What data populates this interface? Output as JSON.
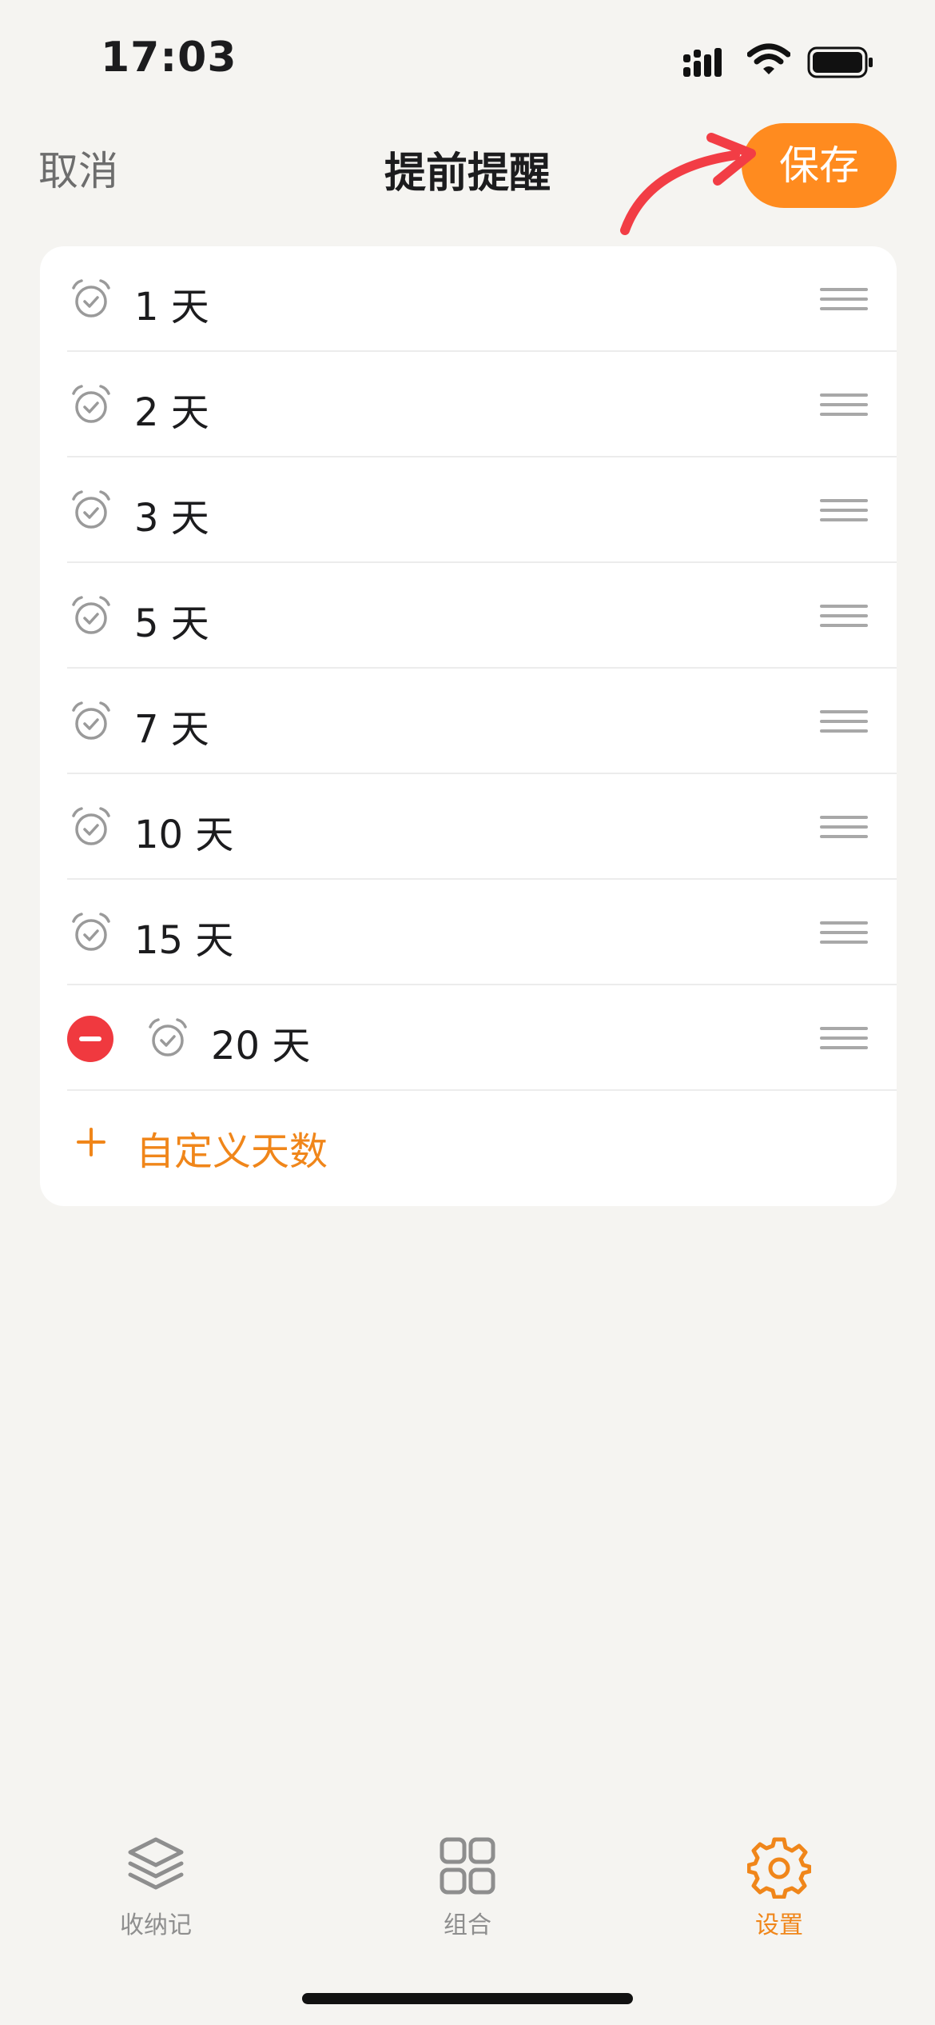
{
  "status_bar": {
    "time": "17:03"
  },
  "nav": {
    "cancel": "取消",
    "title": "提前提醒",
    "save": "保存"
  },
  "reminders": [
    {
      "label": "1 天"
    },
    {
      "label": "2 天"
    },
    {
      "label": "3 天"
    },
    {
      "label": "5 天"
    },
    {
      "label": "7 天"
    },
    {
      "label": "10 天"
    },
    {
      "label": "15 天"
    },
    {
      "label": "20 天",
      "delete_visible": true
    }
  ],
  "add_custom": {
    "label": "自定义天数"
  },
  "tabs": [
    {
      "label": "收纳记",
      "icon": "layers-icon",
      "active": false
    },
    {
      "label": "组合",
      "icon": "grid-icon",
      "active": false
    },
    {
      "label": "设置",
      "icon": "gear-icon",
      "active": true
    }
  ],
  "colors": {
    "accent": "#ff8b1f",
    "accent_text": "#f0861a",
    "delete": "#f0393f",
    "annotation": "#f23d45",
    "inactive": "#8e8e8e"
  }
}
